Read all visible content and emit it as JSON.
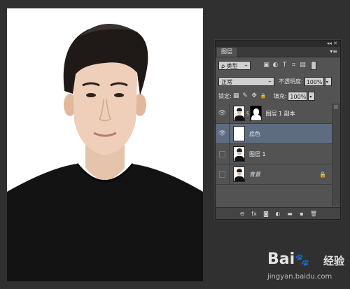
{
  "panel": {
    "collapse_glyph": "◂◂  ✕",
    "tab_label": "图层",
    "menu_glyph": "▾≡",
    "filter": {
      "label": "ρ 类型",
      "icons": [
        "image-filter-icon",
        "adjustment-filter-icon",
        "type-filter-icon",
        "shape-filter-icon",
        "smart-object-filter-icon"
      ],
      "glyphs": [
        "▣",
        "◐",
        "T",
        "⌗",
        "▤"
      ]
    },
    "blend_mode": "正常",
    "opacity_label": "不透明度:",
    "opacity_value": "100%",
    "lock_label": "锁定:",
    "lock_glyphs": [
      "▦",
      "✎",
      "✥",
      "🔒"
    ],
    "fill_label": "填充:",
    "fill_value": "100%",
    "dropdown_arrow": "÷",
    "small_arrow": "▾"
  },
  "layers": [
    {
      "name": "图层 1 副本",
      "visible": true,
      "selected": false,
      "has_mask": true,
      "thumb": "portrait"
    },
    {
      "name": "底色",
      "visible": true,
      "selected": true,
      "has_mask": false,
      "thumb": "white"
    },
    {
      "name": "图层 1",
      "visible": false,
      "selected": false,
      "has_mask": false,
      "thumb": "portrait"
    },
    {
      "name": "背景",
      "visible": false,
      "selected": false,
      "has_mask": false,
      "thumb": "portrait",
      "italic": true,
      "locked": true
    }
  ],
  "eye_glyph": "👁",
  "link_glyph": "§",
  "lock_glyph": "🔒",
  "bottom_bar": {
    "icons": [
      "link-layers-icon",
      "fx-icon",
      "add-mask-icon",
      "adjustment-layer-icon",
      "new-group-icon",
      "new-layer-icon",
      "delete-layer-icon"
    ],
    "glyphs": [
      "⊖",
      "fx",
      "◙",
      "◐",
      "▬",
      "▪",
      "🗑"
    ]
  },
  "watermark": {
    "logo_text_a": "Bai",
    "logo_paw": "🐾",
    "logo_text_b": "经验",
    "url": "jingyan.baidu.com"
  },
  "colors": {
    "panel_bg": "#535353",
    "selected_row": "#5d6c80",
    "workspace_bg": "#303030",
    "baidu_blue": "#2d63d6"
  }
}
